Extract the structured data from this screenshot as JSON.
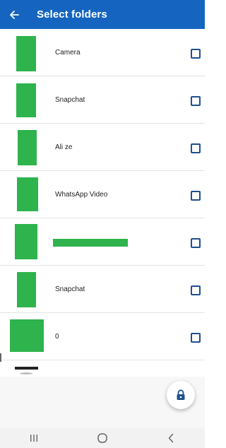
{
  "app_bar": {
    "title": "Select folders",
    "back_icon": "arrow-back-icon",
    "background_color": "#1565c0"
  },
  "folders": [
    {
      "name": "Camera",
      "checked": false
    },
    {
      "name": "Snapchat",
      "checked": false
    },
    {
      "name": "Ali ze",
      "checked": false
    },
    {
      "name": "WhatsApp Video",
      "checked": false
    },
    {
      "name": "",
      "checked": false,
      "name_redacted": true
    },
    {
      "name": "Snapchat",
      "checked": false
    },
    {
      "name": "0",
      "checked": false
    }
  ],
  "thumbnail_color": "#2eb34d",
  "checkbox_color": "#1e4f8c",
  "fab": {
    "icon": "lock-icon"
  },
  "nav_bar": {
    "recent_apps_icon": "recent-apps-icon",
    "home_icon": "home-icon",
    "back_icon": "back-chevron-icon"
  }
}
